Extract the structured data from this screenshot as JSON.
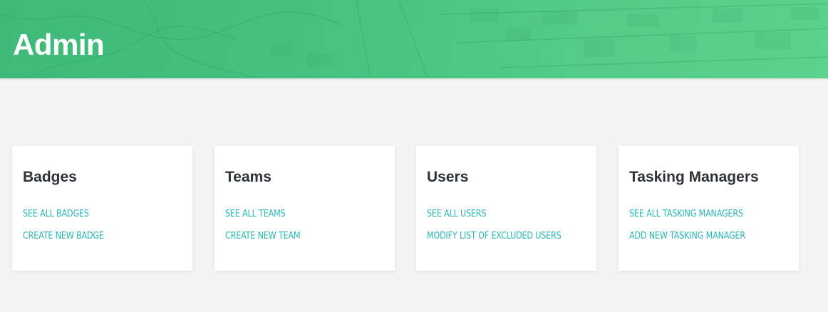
{
  "header": {
    "title": "Admin",
    "background_color": "#4cc584"
  },
  "cards": [
    {
      "title": "Badges",
      "links": [
        "SEE ALL BADGES",
        "CREATE NEW BADGE"
      ]
    },
    {
      "title": "Teams",
      "links": [
        "SEE ALL TEAMS",
        "CREATE NEW TEAM"
      ]
    },
    {
      "title": "Users",
      "links": [
        "SEE ALL USERS",
        "MODIFY LIST OF EXCLUDED USERS"
      ]
    },
    {
      "title": "Tasking Managers",
      "links": [
        "SEE ALL TASKING MANAGERS",
        "ADD NEW TASKING MANAGER"
      ]
    }
  ],
  "theme": {
    "link_color": "#2bb7b5",
    "heading_color": "#2f3337",
    "page_background": "#f4f4f4"
  }
}
